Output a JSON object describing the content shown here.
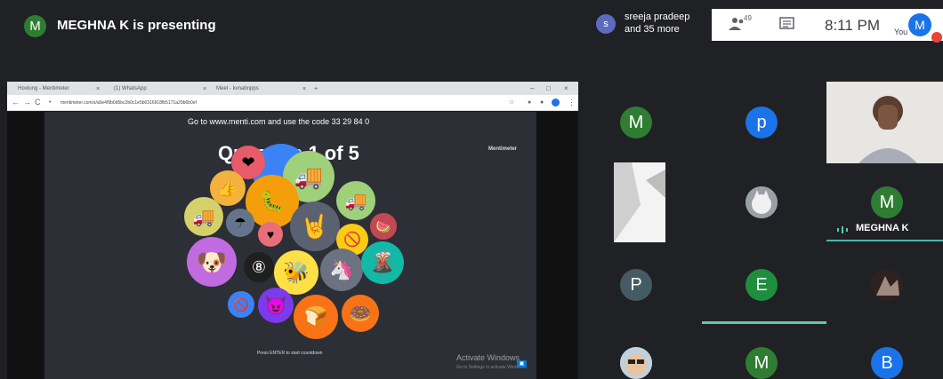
{
  "header": {
    "presenter_initial": "M",
    "presenter_text": "MEGHNA K is presenting"
  },
  "participants": {
    "first_initial": "s",
    "first_name": "sreeja pradeep",
    "more_text": "and 35 more",
    "count": "49"
  },
  "toolbar": {
    "time": "8:11 PM",
    "you_label": "You",
    "self_initial": "M"
  },
  "browser": {
    "tabs": [
      "Hoolung - Mentimeter",
      "(1) WhatsApp",
      "Meet - kvnabnpps"
    ],
    "url": "mentimeter.com/s/a0e4f9b0d5bc2b0c1e5b0316918fb5171a29b6b0ef"
  },
  "menti": {
    "instruction": "Go to www.menti.com and use the code 33 29 84 0",
    "brand": "Mentimeter",
    "question": "Question 1 of 5",
    "footer": "Press ENTER to start countdown"
  },
  "watermark": {
    "title": "Activate Windows",
    "subtitle": "Go to Settings to activate Windows."
  },
  "tiles": [
    {
      "initial": "M",
      "color": "#2f7d32"
    },
    {
      "initial": "p",
      "color": "#1a73e8"
    },
    {
      "initial": "M",
      "color": "#2f7d32"
    },
    {
      "initial": "P",
      "color": "#455a64"
    },
    {
      "initial": "E",
      "color": "#1e8e3e"
    },
    {
      "initial": "M",
      "color": "#2f7d32"
    },
    {
      "initial": "B",
      "color": "#1a73e8"
    }
  ],
  "active_speaker": "MEGHNA K",
  "colors": {
    "meet_dark": "#202124",
    "menti_bg": "#2d2f36",
    "speaking_accent": "#5bc9b0"
  },
  "icons": {
    "people": "people-icon",
    "chat": "chat-icon",
    "speaking": "audio-bars-icon"
  }
}
